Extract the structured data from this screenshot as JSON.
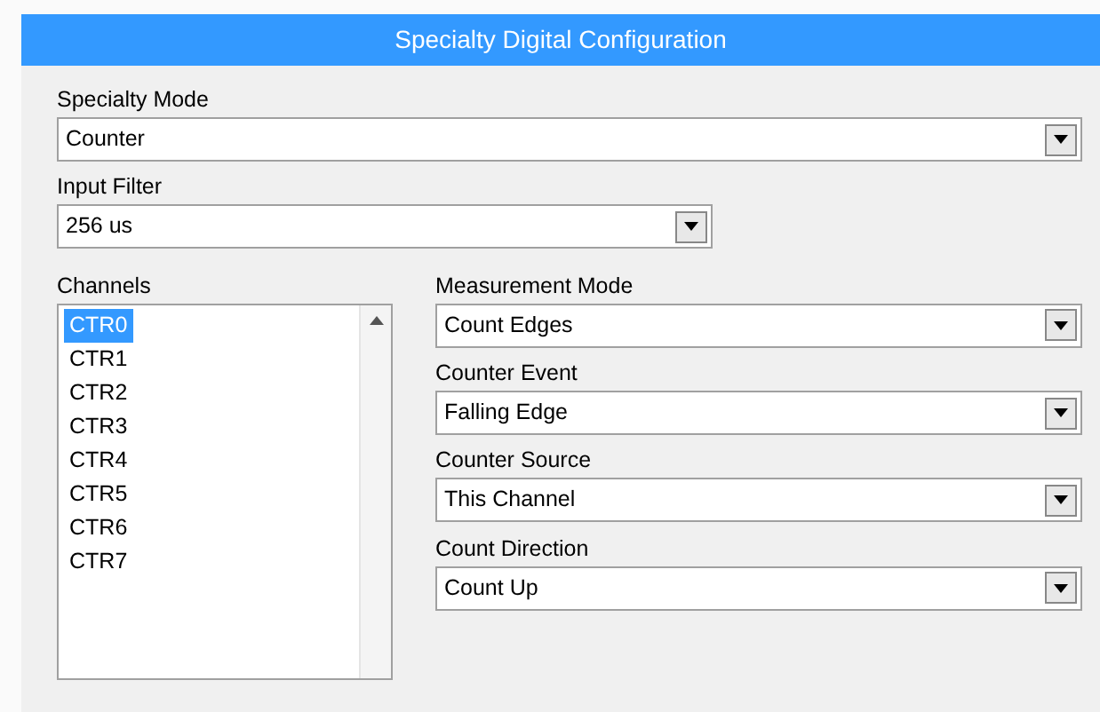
{
  "window": {
    "title": "Specialty Digital Configuration"
  },
  "specialty_mode": {
    "label": "Specialty Mode",
    "value": "Counter"
  },
  "input_filter": {
    "label": "Input Filter",
    "value": "256 us"
  },
  "channels": {
    "label": "Channels",
    "items": [
      {
        "label": "CTR0",
        "selected": true
      },
      {
        "label": "CTR1",
        "selected": false
      },
      {
        "label": "CTR2",
        "selected": false
      },
      {
        "label": "CTR3",
        "selected": false
      },
      {
        "label": "CTR4",
        "selected": false
      },
      {
        "label": "CTR5",
        "selected": false
      },
      {
        "label": "CTR6",
        "selected": false
      },
      {
        "label": "CTR7",
        "selected": false
      }
    ]
  },
  "settings": [
    {
      "label": "Measurement Mode",
      "value": "Count Edges"
    },
    {
      "label": "Counter Event",
      "value": "Falling Edge"
    },
    {
      "label": "Counter Source",
      "value": "This Channel"
    },
    {
      "label": "Count Direction",
      "value": "Count Up"
    }
  ]
}
